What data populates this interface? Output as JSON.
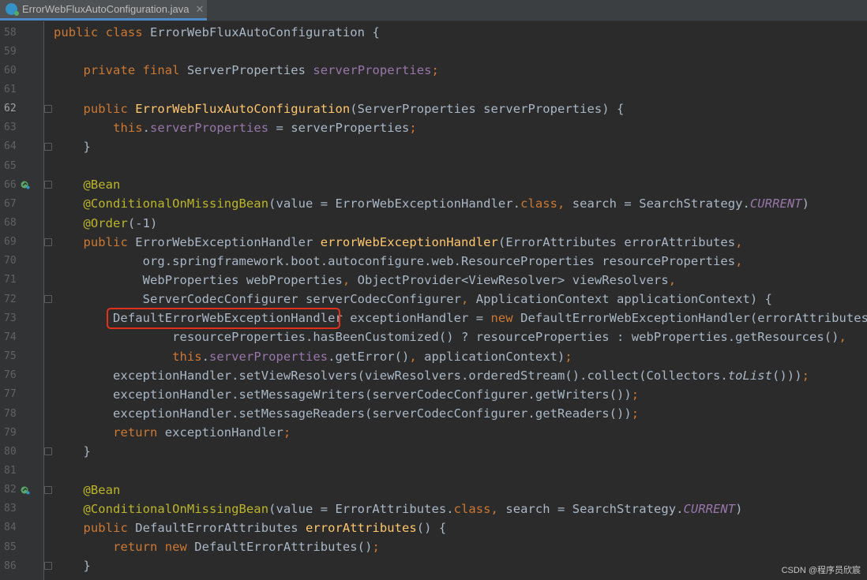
{
  "tab": {
    "title": "ErrorWebFluxAutoConfiguration.java",
    "close": "✕",
    "icon": "java-class-icon"
  },
  "lines": [
    {
      "n": "58",
      "text": "public class ErrorWebFluxAutoConfiguration {"
    },
    {
      "n": "59",
      "text": ""
    },
    {
      "n": "60",
      "text": "    private final ServerProperties serverProperties;"
    },
    {
      "n": "61",
      "text": ""
    },
    {
      "n": "62",
      "text": "    public ErrorWebFluxAutoConfiguration(ServerProperties serverProperties) {"
    },
    {
      "n": "63",
      "text": "        this.serverProperties = serverProperties;"
    },
    {
      "n": "64",
      "text": "    }"
    },
    {
      "n": "65",
      "text": ""
    },
    {
      "n": "66",
      "text": "    @Bean"
    },
    {
      "n": "67",
      "text": "    @ConditionalOnMissingBean(value = ErrorWebExceptionHandler.class, search = SearchStrategy.CURRENT)"
    },
    {
      "n": "68",
      "text": "    @Order(-1)"
    },
    {
      "n": "69",
      "text": "    public ErrorWebExceptionHandler errorWebExceptionHandler(ErrorAttributes errorAttributes,"
    },
    {
      "n": "70",
      "text": "            org.springframework.boot.autoconfigure.web.ResourceProperties resourceProperties,"
    },
    {
      "n": "71",
      "text": "            WebProperties webProperties, ObjectProvider<ViewResolver> viewResolvers,"
    },
    {
      "n": "72",
      "text": "            ServerCodecConfigurer serverCodecConfigurer, ApplicationContext applicationContext) {"
    },
    {
      "n": "73",
      "text": "        DefaultErrorWebExceptionHandler exceptionHandler = new DefaultErrorWebExceptionHandler(errorAttributes,"
    },
    {
      "n": "74",
      "text": "                resourceProperties.hasBeenCustomized() ? resourceProperties : webProperties.getResources(),"
    },
    {
      "n": "75",
      "text": "                this.serverProperties.getError(), applicationContext);"
    },
    {
      "n": "76",
      "text": "        exceptionHandler.setViewResolvers(viewResolvers.orderedStream().collect(Collectors.toList()));"
    },
    {
      "n": "77",
      "text": "        exceptionHandler.setMessageWriters(serverCodecConfigurer.getWriters());"
    },
    {
      "n": "78",
      "text": "        exceptionHandler.setMessageReaders(serverCodecConfigurer.getReaders());"
    },
    {
      "n": "79",
      "text": "        return exceptionHandler;"
    },
    {
      "n": "80",
      "text": "    }"
    },
    {
      "n": "81",
      "text": ""
    },
    {
      "n": "82",
      "text": "    @Bean"
    },
    {
      "n": "83",
      "text": "    @ConditionalOnMissingBean(value = ErrorAttributes.class, search = SearchStrategy.CURRENT)"
    },
    {
      "n": "84",
      "text": "    public DefaultErrorAttributes errorAttributes() {"
    },
    {
      "n": "85",
      "text": "        return new DefaultErrorAttributes();"
    },
    {
      "n": "86",
      "text": "    }"
    }
  ],
  "highlighted_token": "DefaultErrorWebExceptionHandler",
  "watermark": "CSDN @程序员欣宸",
  "colors": {
    "background": "#2b2b2b",
    "keyword": "#cc7832",
    "field": "#9876aa",
    "method": "#ffc66d",
    "annotation": "#bbb529",
    "number": "#6897bb",
    "plain": "#a9b7c6",
    "highlight_border": "#e0321b"
  }
}
